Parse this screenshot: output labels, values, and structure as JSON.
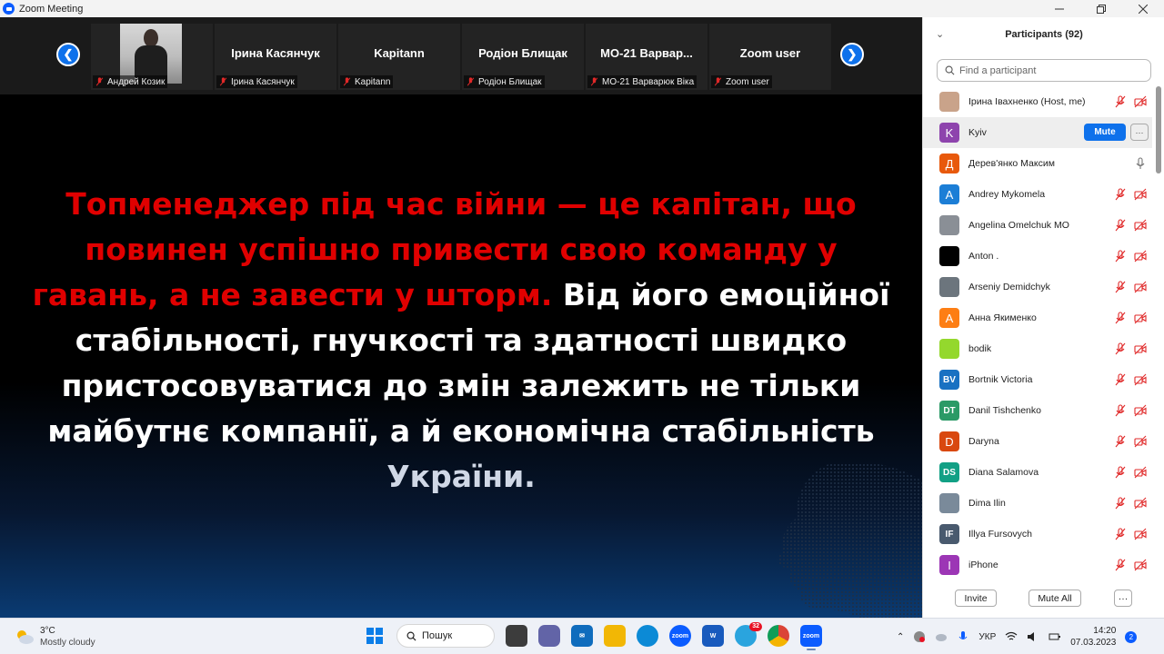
{
  "window": {
    "title": "Zoom Meeting"
  },
  "video_strip": {
    "tiles": [
      {
        "header": "",
        "footer": "Андрей Козик"
      },
      {
        "header": "Ірина Касянчук",
        "footer": "Ірина Касянчук"
      },
      {
        "header": "Kapitann",
        "footer": "Kapitann"
      },
      {
        "header": "Родіон Блищак",
        "footer": "Родіон Блищак"
      },
      {
        "header": "МО-21  Варвар...",
        "footer": "МО-21 Варварюк Віка"
      },
      {
        "header": "Zoom user",
        "footer": "Zoom user"
      }
    ]
  },
  "share": {
    "text_red": "Топменеджер під час війни — це капітан, що повинен успішно привести свою команду у гавань, а не завести у шторм.",
    "text_white": "Від його емоційної стабільності, гнучкості та здатності швидко пристосовуватися до змін залежить не тільки майбутнє компанії, а й економічна стабільність",
    "text_last": "України."
  },
  "participants": {
    "title": "Participants (92)",
    "search_placeholder": "Find a participant",
    "mute_label": "Mute",
    "more_label": "···",
    "list": [
      {
        "name": "Ірина Івахненко (Host, me)",
        "initials": "",
        "color": "#c9a38a",
        "mic": "off"
      },
      {
        "name": "Kyiv",
        "initials": "K",
        "color": "#8e44ad",
        "mic": "hover"
      },
      {
        "name": "Дерев'янко Максим",
        "initials": "Д",
        "color": "#e8590c",
        "mic": "on"
      },
      {
        "name": "Andrey Mykomela",
        "initials": "A",
        "color": "#1c7ed6",
        "mic": "off"
      },
      {
        "name": "Angelina Omelchuk MO",
        "initials": "",
        "color": "#8a8f96",
        "mic": "off"
      },
      {
        "name": "Anton .",
        "initials": "",
        "color": "#000000",
        "mic": "off"
      },
      {
        "name": "Arseniy Demidchyk",
        "initials": "",
        "color": "#6c757d",
        "mic": "off"
      },
      {
        "name": "Анна Якименко",
        "initials": "А",
        "color": "#fd7e14",
        "mic": "off"
      },
      {
        "name": "bodik",
        "initials": "",
        "color": "#94d82d",
        "mic": "off"
      },
      {
        "name": "Bortnik Victoria",
        "initials": "BV",
        "color": "#1971c2",
        "mic": "off"
      },
      {
        "name": "Danil Tishchenko",
        "initials": "DT",
        "color": "#2b9a66",
        "mic": "off"
      },
      {
        "name": "Daryna",
        "initials": "D",
        "color": "#d9480f",
        "mic": "off"
      },
      {
        "name": "Diana Salamova",
        "initials": "DS",
        "color": "#12a085",
        "mic": "off"
      },
      {
        "name": "Dima Ilin",
        "initials": "",
        "color": "#7a8a9a",
        "mic": "off"
      },
      {
        "name": "Illya Fursovych",
        "initials": "IF",
        "color": "#495a6e",
        "mic": "off"
      },
      {
        "name": "iPhone",
        "initials": "I",
        "color": "#9c36b5",
        "mic": "off"
      }
    ],
    "invite_label": "Invite",
    "mute_all_label": "Mute All",
    "footer_more": "···"
  },
  "taskbar": {
    "temp": "3°C",
    "condition": "Mostly cloudy",
    "search_label": "Пошук",
    "telegram_badge": "32",
    "language": "УКР",
    "time": "14:20",
    "date": "07.03.2023",
    "notifications": "2"
  }
}
